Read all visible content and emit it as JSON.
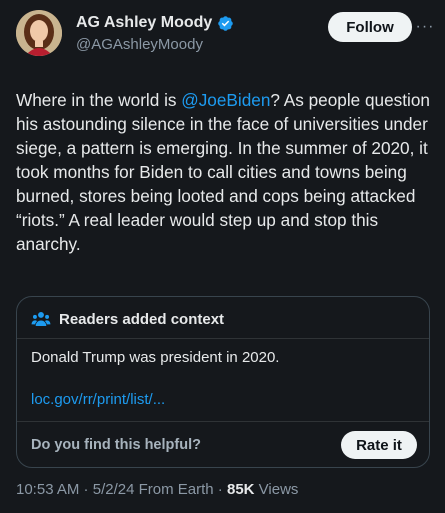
{
  "author": {
    "display_name": "AG Ashley Moody",
    "handle": "@AGAshleyMoody",
    "verified": true
  },
  "actions": {
    "follow_label": "Follow",
    "more_label": "···"
  },
  "tweet": {
    "text_before_mention": "Where in the world is ",
    "mention": "@JoeBiden",
    "text_after_mention": "? As people question his astounding silence in the face of universities under siege, a pattern is emerging. In the summer of 2020, it took months for Biden to call cities and towns being burned, stores being looted and cops being attacked “riots.” A real leader would step up and stop this anarchy."
  },
  "community_note": {
    "title": "Readers added context",
    "note_text": "Donald Trump was president in 2020.",
    "link_text": "loc.gov/rr/print/list/...",
    "helpful_prompt": "Do you find this helpful?",
    "rate_label": "Rate it"
  },
  "meta": {
    "time": "10:53 AM",
    "separator": " · ",
    "date": "5/2/24",
    "source": "From Earth",
    "views_count": "85K",
    "views_label": " Views"
  },
  "colors": {
    "background": "#15181c",
    "accent": "#1d9bf0",
    "text_primary": "#e7e9ea",
    "text_secondary": "#8b98a5",
    "border": "#38444d"
  },
  "icons": {
    "verified": "verified-badge-icon",
    "more": "more-icon",
    "readers": "readers-icon"
  }
}
